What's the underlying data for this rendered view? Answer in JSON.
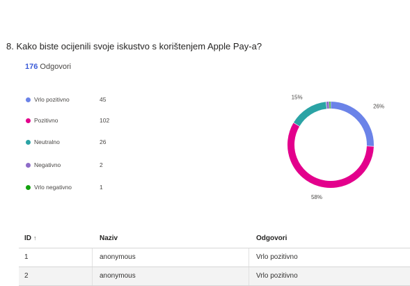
{
  "question": {
    "title": "8. Kako biste ocijenili svoje iskustvo s korištenjem Apple Pay-a?"
  },
  "responses": {
    "count": "176",
    "label": "Odgovori"
  },
  "legend": [
    {
      "label": "Vrlo pozitivno",
      "value": "45",
      "color": "#6b83e8"
    },
    {
      "label": "Pozitivno",
      "value": "102",
      "color": "#e3008c"
    },
    {
      "label": "Neutralno",
      "value": "26",
      "color": "#2ba3a5"
    },
    {
      "label": "Negativno",
      "value": "2",
      "color": "#8e6cc8"
    },
    {
      "label": "Vrlo negativno",
      "value": "1",
      "color": "#13a10e"
    }
  ],
  "chart_data": {
    "type": "pie",
    "categories": [
      "Vrlo pozitivno",
      "Pozitivno",
      "Neutralno",
      "Negativno",
      "Vrlo negativno"
    ],
    "values": [
      45,
      102,
      26,
      2,
      1
    ],
    "colors": [
      "#6b83e8",
      "#e3008c",
      "#2ba3a5",
      "#8e6cc8",
      "#13a10e"
    ],
    "percent_labels": [
      "26%",
      "58%",
      "15%",
      "",
      ""
    ],
    "donut": true
  },
  "table": {
    "headers": {
      "id": "ID",
      "sort_icon": "↑",
      "name": "Naziv",
      "answers": "Odgovori"
    },
    "rows": [
      {
        "id": "1",
        "name": "anonymous",
        "answer": "Vrlo pozitivno"
      },
      {
        "id": "2",
        "name": "anonymous",
        "answer": "Vrlo pozitivno"
      }
    ]
  }
}
